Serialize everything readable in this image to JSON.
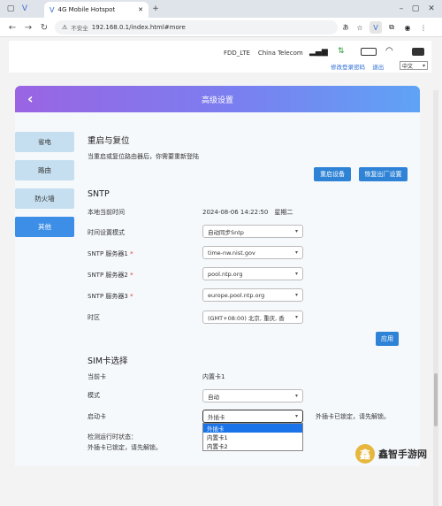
{
  "browser": {
    "tab_title": "4G Mobile Hotspot",
    "insecure_label": "不安全",
    "url": "192.168.0.1/index.html#more",
    "translate_label": "Ꮹ"
  },
  "status": {
    "network_type": "FDD_LTE",
    "operator": "China Telecom",
    "change_password": "修改登录密码",
    "logout": "退出",
    "language": "中文"
  },
  "header": {
    "title": "高级设置"
  },
  "sidebar": {
    "items": [
      {
        "label": "省电"
      },
      {
        "label": "路由"
      },
      {
        "label": "防火墙"
      },
      {
        "label": "其他"
      }
    ]
  },
  "reboot": {
    "title": "重启与复位",
    "desc": "当重启或复位路由器后，你需要重新登陆",
    "restart_btn": "重启设备",
    "factory_btn": "恢复出厂设置"
  },
  "sntp": {
    "title": "SNTP",
    "current_time_label": "本地当前时间",
    "current_time_value": "2024-08-06 14:22:50　星期二",
    "mode_label": "时间设置模式",
    "mode_value": "自动同步Sntp",
    "server1_label": "SNTP 服务器1",
    "server1_value": "time-nw.nist.gov",
    "server2_label": "SNTP 服务器2",
    "server2_value": "pool.ntp.org",
    "server3_label": "SNTP 服务器3",
    "server3_value": "europe.pool.ntp.org",
    "timezone_label": "时区",
    "timezone_value": "(GMT+08:00) 北京, 重庆, 香",
    "apply_btn": "应用",
    "star": "*"
  },
  "sim": {
    "title": "SIM卡选择",
    "current_label": "当前卡",
    "current_value": "内置卡1",
    "mode_label": "模式",
    "mode_value": "自动",
    "boot_label": "启动卡",
    "boot_value": "外插卡",
    "boot_note": "外插卡已锁定，请先解锁。",
    "status_label": "检测运行时状态：",
    "status_value": "外插卡已锁定，请先解锁。",
    "options": [
      "外插卡",
      "内置卡1",
      "内置卡2"
    ]
  },
  "watermark": {
    "text": "鑫智手游网"
  }
}
